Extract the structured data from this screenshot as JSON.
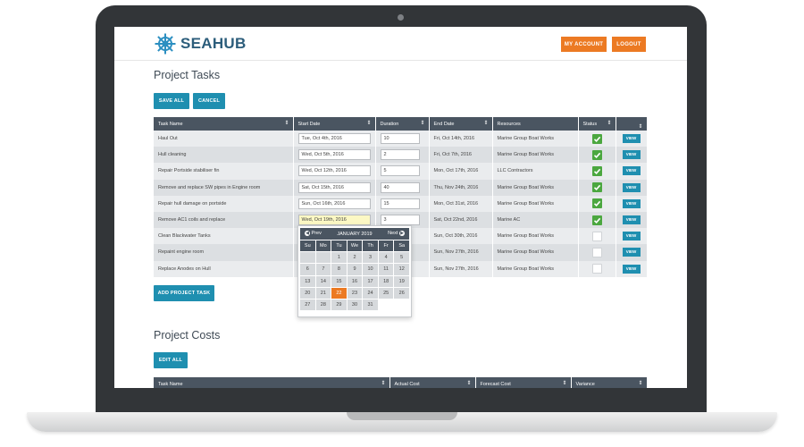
{
  "brand": {
    "name": "SEAHUB",
    "color": "#2c5d7b"
  },
  "colors": {
    "accent_orange": "#ec7a23",
    "accent_teal": "#1f8fb0",
    "header_dark": "#4a5561",
    "status_green": "#4ba73f"
  },
  "header": {
    "my_account": "MY ACCOUNT",
    "logout": "LOGOUT"
  },
  "tasks": {
    "title": "Project Tasks",
    "save_all": "SAVE ALL",
    "cancel": "CANCEL",
    "add_task": "ADD PROJECT TASK",
    "columns": [
      "Task Name",
      "Start Date",
      "Duration",
      "End Date",
      "Resources",
      "Status",
      ""
    ],
    "rows": [
      {
        "name": "Haul Out",
        "start": "Tue, Oct 4th, 2016",
        "duration": "10",
        "end": "Fri, Oct 14th, 2016",
        "resource": "Marine Group Boat Works",
        "done": true,
        "view": "VIEW"
      },
      {
        "name": "Hull cleaning",
        "start": "Wed, Oct 5th, 2016",
        "duration": "2",
        "end": "Fri, Oct 7th, 2016",
        "resource": "Marine Group Boat Works",
        "done": true,
        "view": "VIEW"
      },
      {
        "name": "Repair Portside stabiliser fin",
        "start": "Wed, Oct 12th, 2016",
        "duration": "5",
        "end": "Mon, Oct 17th, 2016",
        "resource": "LLC Contractors",
        "done": true,
        "view": "VIEW"
      },
      {
        "name": "Remove and replace SW pipes in Engine room",
        "start": "Sat, Oct 15th, 2016",
        "duration": "40",
        "end": "Thu, Nov 24th, 2016",
        "resource": "Marine Group Boat Works",
        "done": true,
        "view": "VIEW"
      },
      {
        "name": "Repair hull damage on portside",
        "start": "Sun, Oct 16th, 2016",
        "duration": "15",
        "end": "Mon, Oct 31st, 2016",
        "resource": "Marine Group Boat Works",
        "done": true,
        "view": "VIEW"
      },
      {
        "name": "Remove AC1 coils and replace",
        "start": "Wed, Oct 19th, 2016",
        "duration": "3",
        "end": "Sat, Oct 22nd, 2016",
        "resource": "Marine AC",
        "done": true,
        "view": "VIEW"
      },
      {
        "name": "Clean Blackwater Tanks",
        "start": "",
        "duration": "",
        "end": "Sun, Oct 30th, 2016",
        "resource": "Marine Group Boat Works",
        "done": false,
        "view": "VIEW"
      },
      {
        "name": "Repaint engine room",
        "start": "",
        "duration": "",
        "end": "Sun, Nov 27th, 2016",
        "resource": "Marine Group Boat Works",
        "done": false,
        "view": "VIEW"
      },
      {
        "name": "Replace Anodes on Hull",
        "start": "",
        "duration": "",
        "end": "Sun, Nov 27th, 2016",
        "resource": "Marine Group Boat Works",
        "done": false,
        "view": "VIEW"
      }
    ]
  },
  "datepicker": {
    "prev": "Prev",
    "next": "Next",
    "month": "JANUARY 2019",
    "days_of_week": [
      "Su",
      "Mo",
      "Tu",
      "We",
      "Th",
      "Fr",
      "Sa"
    ],
    "leading_blanks": 2,
    "days": 31,
    "selected": 22
  },
  "costs": {
    "title": "Project Costs",
    "edit_all": "EDIT ALL",
    "columns": [
      "Task Name",
      "Actual Cost",
      "Forecast Cost",
      "Variance"
    ]
  }
}
